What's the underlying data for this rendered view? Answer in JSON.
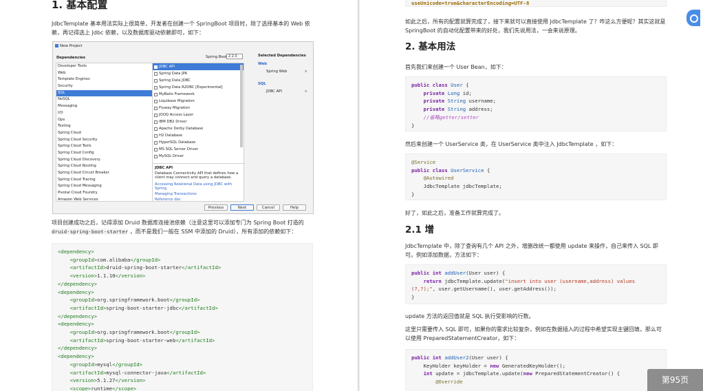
{
  "left": {
    "heading": "1. 基本配置",
    "intro": "JdbcTemplate 基本用法实际上很简单，开发者在创建一个 SpringBoot 项目时，除了选择基本的 Web 依赖，再记得选上 Jdbc 依赖，以及数据库驱动依赖即可，如下：",
    "dialog": {
      "title": "New Project",
      "deps_label": "Dependencies",
      "springboot_label": "Spring Boot",
      "springboot_version": "2.2.0",
      "categories": [
        "Developer Tools",
        "Web",
        "Template Engines",
        "Security",
        "SQL",
        "NoSQL",
        "Messaging",
        "I/O",
        "Ops",
        "Testing",
        "Spring Cloud",
        "Spring Cloud Security",
        "Spring Cloud Tools",
        "Spring Cloud Config",
        "Spring Cloud Discovery",
        "Spring Cloud Routing",
        "Spring Cloud Circuit Breaker",
        "Spring Cloud Tracing",
        "Spring Cloud Messaging",
        "Pivotal Cloud Foundry",
        "Amazon Web Services"
      ],
      "selected_category": "SQL",
      "dependencies": [
        "JDBC API",
        "Spring Data JPA",
        "Spring Data JDBC",
        "Spring Data R2DBC [Experimental]",
        "MyBatis Framework",
        "Liquibase Migration",
        "Flyway Migration",
        "JOOQ Access Layer",
        "IBM DB2 Driver",
        "Apache Derby Database",
        "H2 Database",
        "HyperSQL Database",
        "MS SQL Server Driver",
        "MySQL Driver"
      ],
      "checked_dependency": "JDBC API",
      "desc_title": "JDBC API",
      "desc_text": "Database Connectivity API that defines how a client may connect and query a database.",
      "desc_links": [
        "Accessing Relational Data using JDBC with Spring",
        "Managing Transactions",
        "Reference doc"
      ],
      "selected_title": "Selected Dependencies",
      "selected_groups": [
        {
          "name": "Web",
          "items": [
            "Spring Web"
          ]
        },
        {
          "name": "SQL",
          "items": [
            "JDBC API"
          ]
        }
      ],
      "buttons": {
        "previous": "Previous",
        "next": "Next",
        "cancel": "Cancel",
        "help": "Help"
      }
    },
    "after_dialog_a": "项目创建成功之后，记得添加 Druid 数据库连接池依赖（注意这里可以添加专门为 Spring Boot 打造的",
    "after_dialog_b": "druid-spring-boot-starter",
    "after_dialog_c": "，而不是我们一般在 SSM 中添加的 Druid），所有添加的依赖如下："
  },
  "right": {
    "top_code": "useUnicode=true&characterEncoding=UTF-8",
    "p_after_config": "如此之后，所有的配置就算完成了，接下来就可以直接使用 JdbcTemplate 了？咋这么方便呢？其实这就是 SpringBoot 的自动化配置带来的好处，我们先说用法，一会来说原理。",
    "heading2": "2. 基本用法",
    "p_bean": "首先我们来创建一个 User Bean，如下：",
    "p_service": "然后来创建一个 UserService 类，在 UserService 类中注入 JdbcTemplate ，如下：",
    "p_ready": "好了，如此之后，准备工作就算完成了。",
    "heading21": "2.1 增",
    "p_update": "JdbcTemplate 中，除了查询有几个 API 之外，增删改统一都使用 update 来操作，自己来传入 SQL 即可。例如添加数据，方法如下：",
    "p_return": "update 方法的返回值就是 SQL 执行受影响的行数。",
    "p_key": "这里只需要传入 SQL 即可，如果你的需求比较复杂，例如在数据插入的过程中希望实现主键回填，那么可以使用 PreparedStatementCreator，如下："
  },
  "page_indicator": "第95页"
}
